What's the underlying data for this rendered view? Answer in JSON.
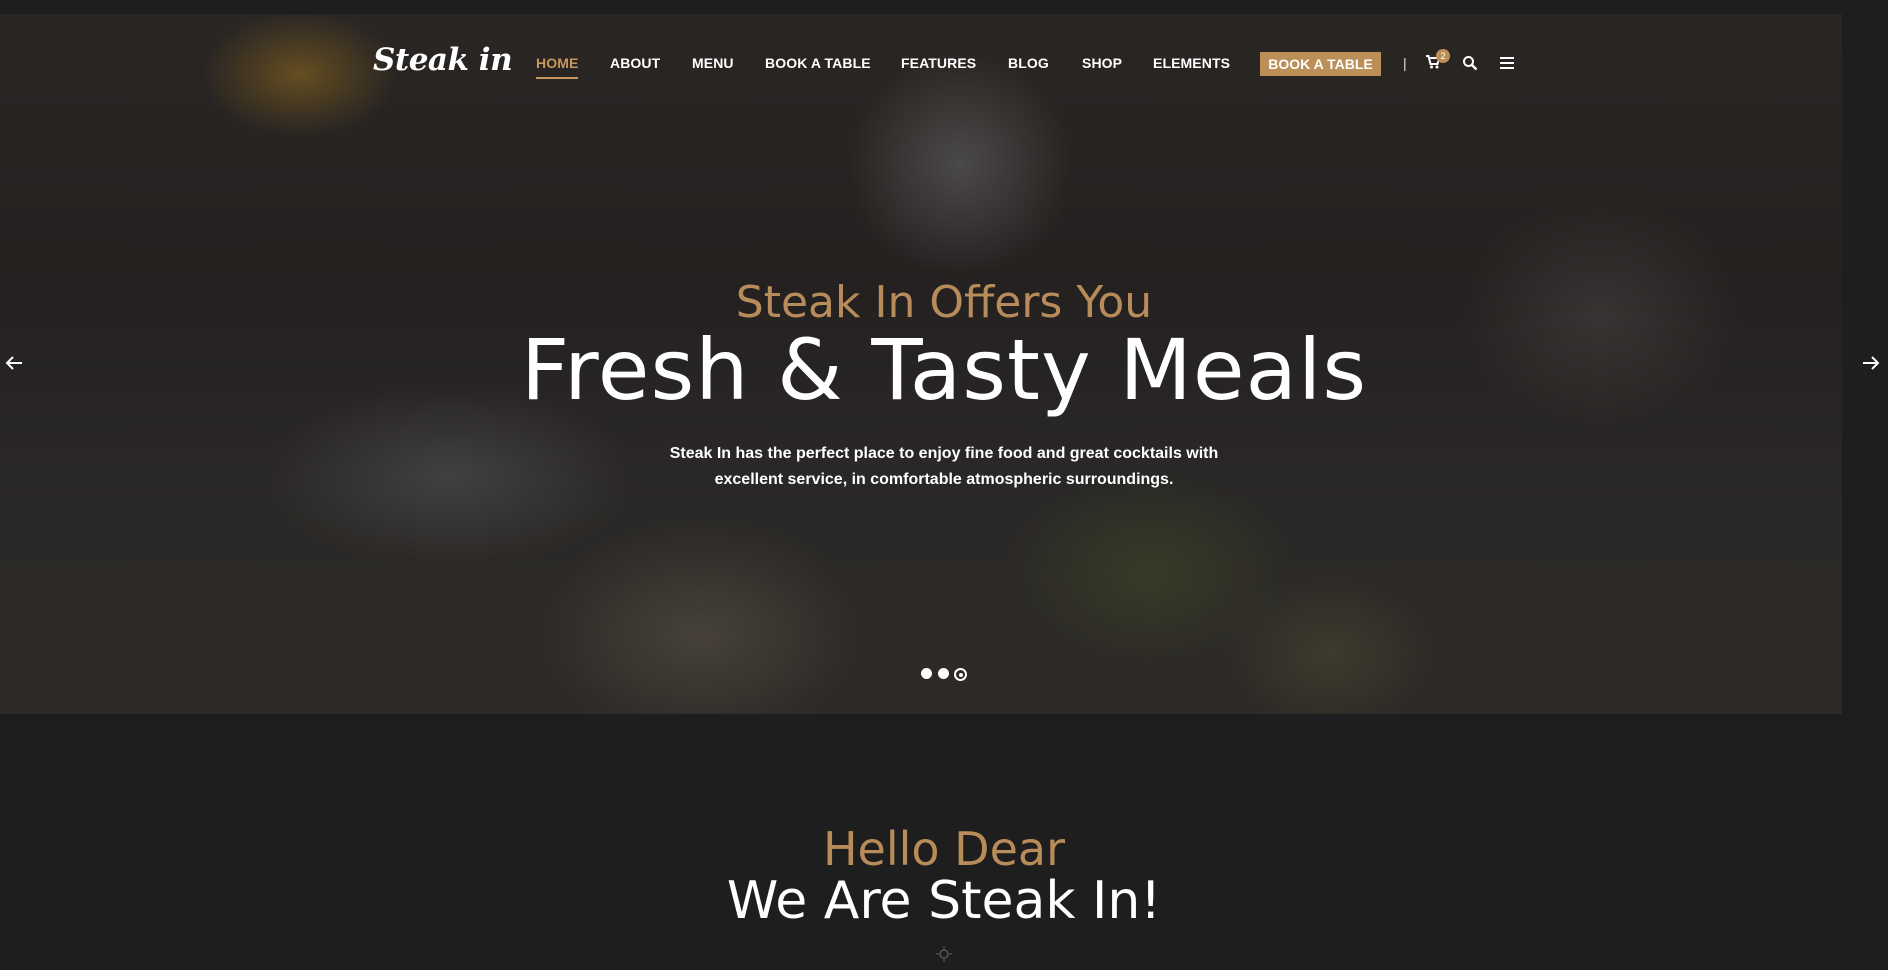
{
  "logo": {
    "text": "Steak in"
  },
  "nav": {
    "items": [
      {
        "label": "HOME",
        "active": true
      },
      {
        "label": "ABOUT"
      },
      {
        "label": "MENU"
      },
      {
        "label": "BOOK A TABLE"
      },
      {
        "label": "FEATURES"
      },
      {
        "label": "BLOG"
      },
      {
        "label": "SHOP"
      },
      {
        "label": "ELEMENTS"
      }
    ],
    "book_button": "BOOK A TABLE",
    "separator": "|",
    "cart_count": "2",
    "icons": {
      "cart": "cart-icon",
      "search": "search-icon",
      "menu": "hamburger-icon"
    }
  },
  "hero": {
    "subtitle": "Steak In Offers You",
    "title": "Fresh & Tasty Meals",
    "description_line1": "Steak In has the perfect place to enjoy fine food and great cocktails with",
    "description_line2": "excellent service, in comfortable atmospheric surroundings.",
    "slides_total": 3,
    "active_slide": 3
  },
  "intro": {
    "subtitle": "Hello Dear",
    "title": "We Are Steak In!"
  },
  "colors": {
    "accent": "#bd8f58",
    "background": "#1e1e1e"
  }
}
